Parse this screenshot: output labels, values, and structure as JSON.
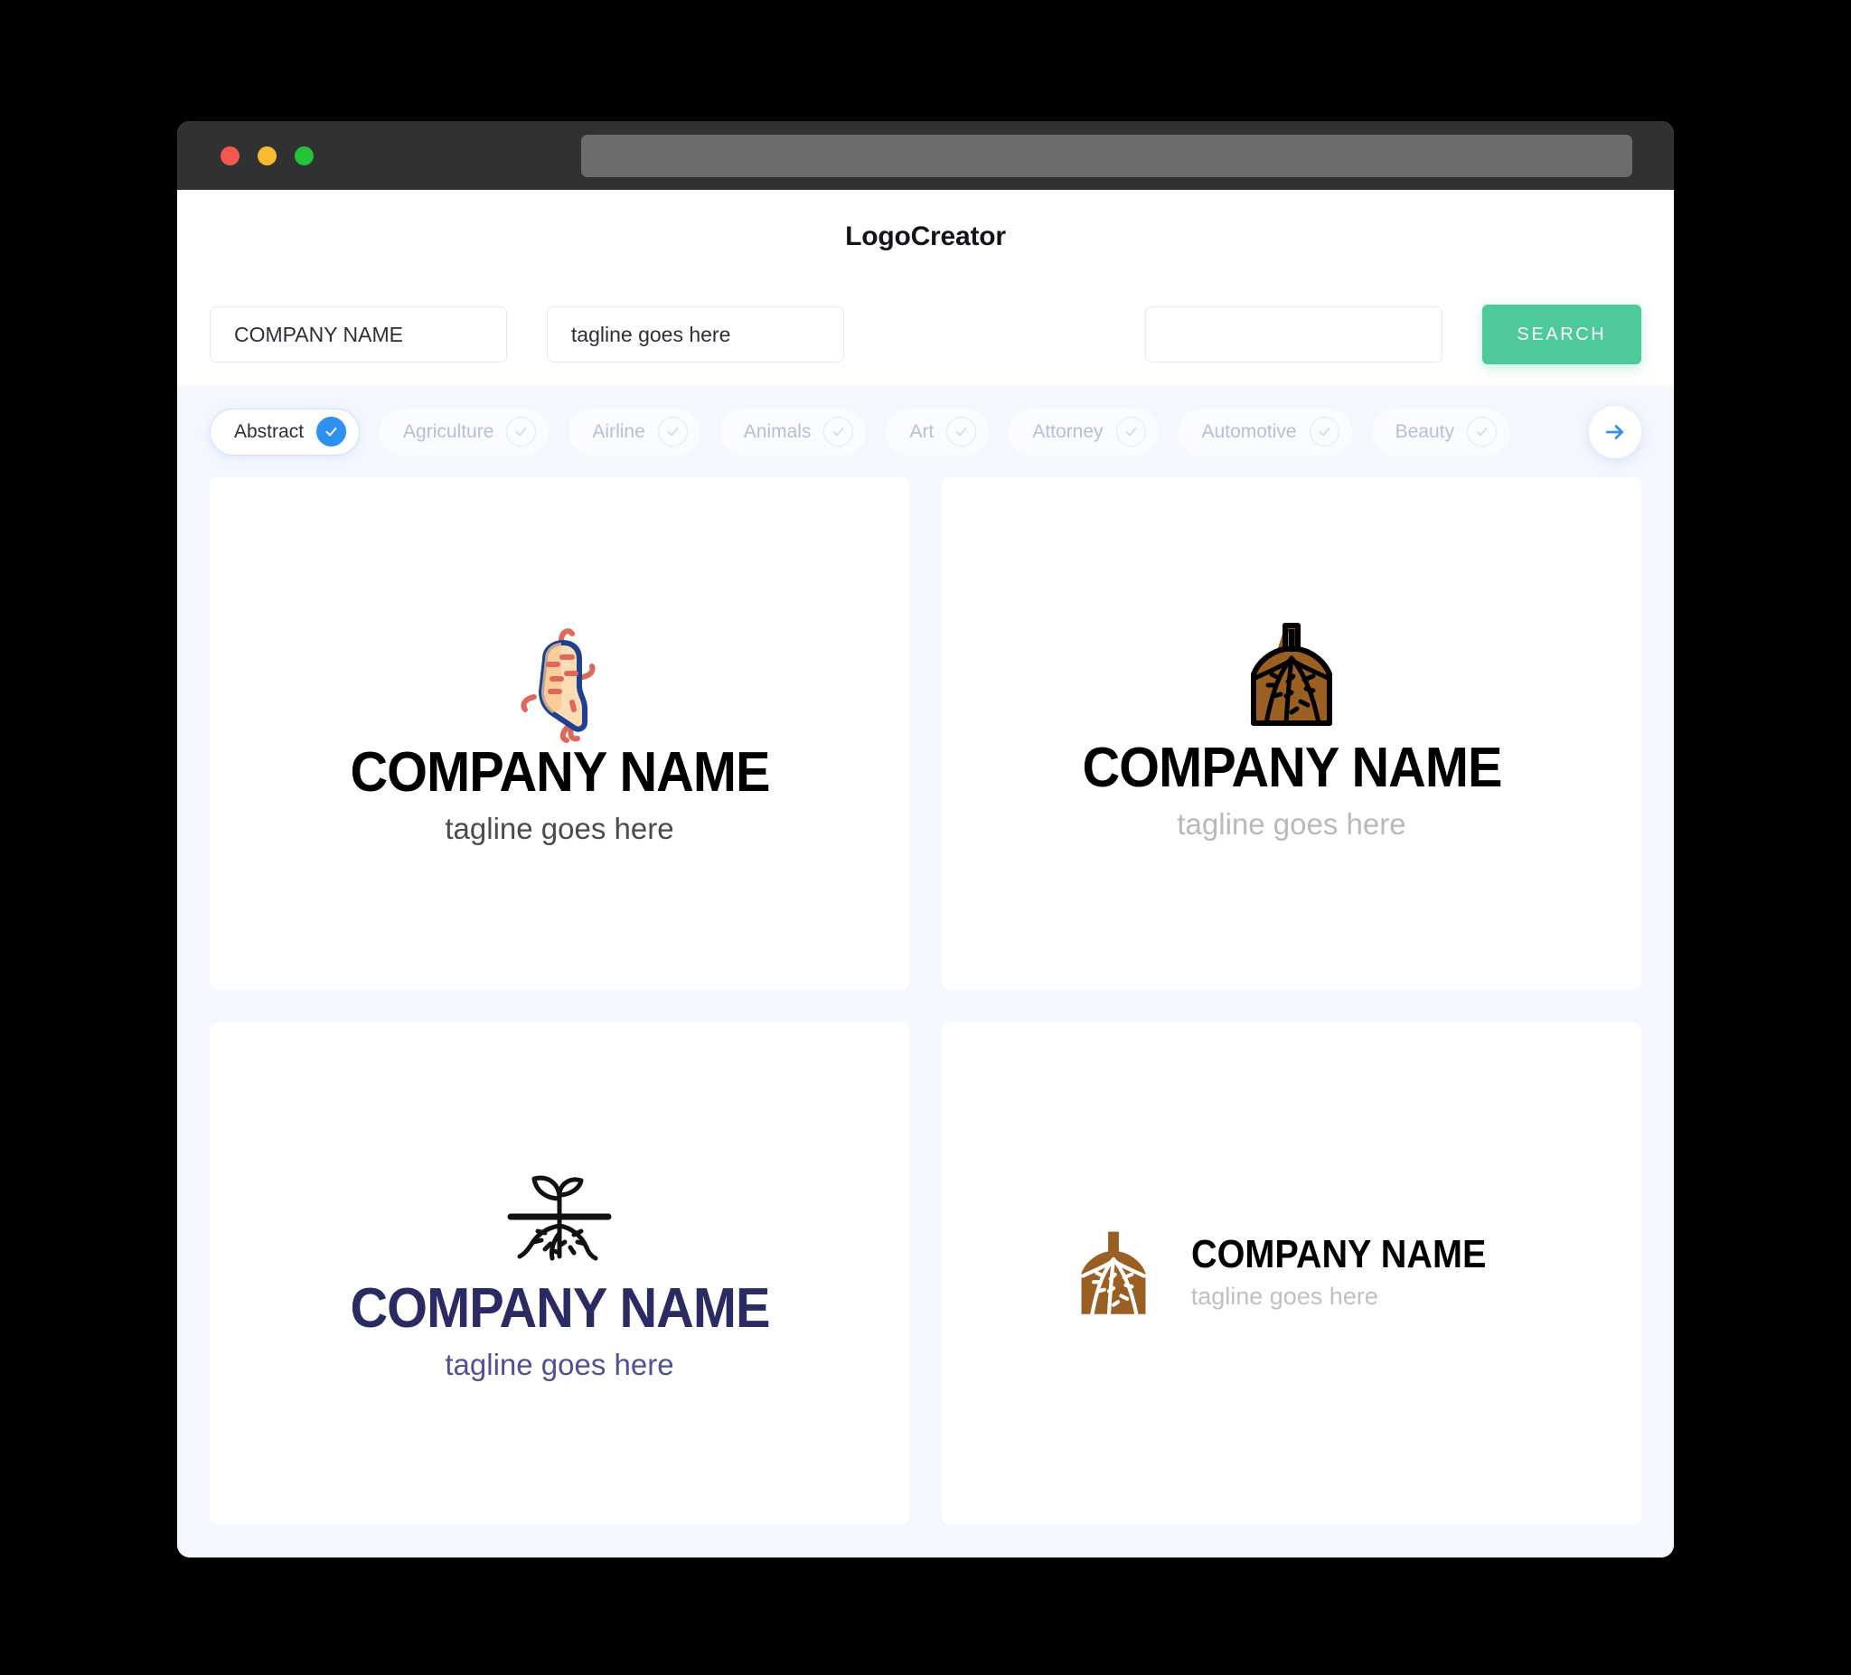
{
  "window": {
    "traffic_lights": [
      "close",
      "minimize",
      "maximize"
    ],
    "url_bar_value": ""
  },
  "header": {
    "title": "LogoCreator"
  },
  "search": {
    "company_name_value": "COMPANY NAME",
    "company_name_placeholder": "COMPANY NAME",
    "tagline_value": "tagline goes here",
    "tagline_placeholder": "tagline goes here",
    "extra_value": "",
    "extra_placeholder": "",
    "search_label": "SEARCH"
  },
  "categories": {
    "next_icon": "arrow-right-icon",
    "items": [
      {
        "label": "Abstract",
        "selected": true
      },
      {
        "label": "Agriculture",
        "selected": false
      },
      {
        "label": "Airline",
        "selected": false
      },
      {
        "label": "Animals",
        "selected": false
      },
      {
        "label": "Art",
        "selected": false
      },
      {
        "label": "Attorney",
        "selected": false
      },
      {
        "label": "Automotive",
        "selected": false
      },
      {
        "label": "Beauty",
        "selected": false
      }
    ]
  },
  "logos": [
    {
      "icon": "ginger-root-icon",
      "layout": "stacked",
      "name": "COMPANY NAME",
      "tagline": "tagline goes here",
      "name_color": "#000000",
      "tagline_color": "#4b4b4b"
    },
    {
      "icon": "tree-root-icon",
      "layout": "stacked",
      "name": "COMPANY NAME",
      "tagline": "tagline goes here",
      "name_color": "#000000",
      "tagline_color": "#b9b9b9"
    },
    {
      "icon": "sprout-roots-icon",
      "layout": "stacked",
      "name": "COMPANY NAME",
      "tagline": "tagline goes here",
      "name_color": "#2b2b63",
      "tagline_color": "#4f5196"
    },
    {
      "icon": "tree-root-icon",
      "layout": "horizontal",
      "name": "COMPANY NAME",
      "tagline": "tagline goes here",
      "name_color": "#000000",
      "tagline_color": "#c0c0c0"
    }
  ],
  "colors": {
    "page_background": "#000000",
    "app_background": "#f4f7fe",
    "card_background": "#ffffff",
    "accent_green": "#4ec99a",
    "accent_blue": "#2f90f2",
    "titlebar": "#2f3133",
    "root_brown": "#9a5f22",
    "ginger_fill": "#fbdcb4",
    "ginger_outline": "#1f3f8f",
    "ginger_hairs": "#e0685a"
  }
}
